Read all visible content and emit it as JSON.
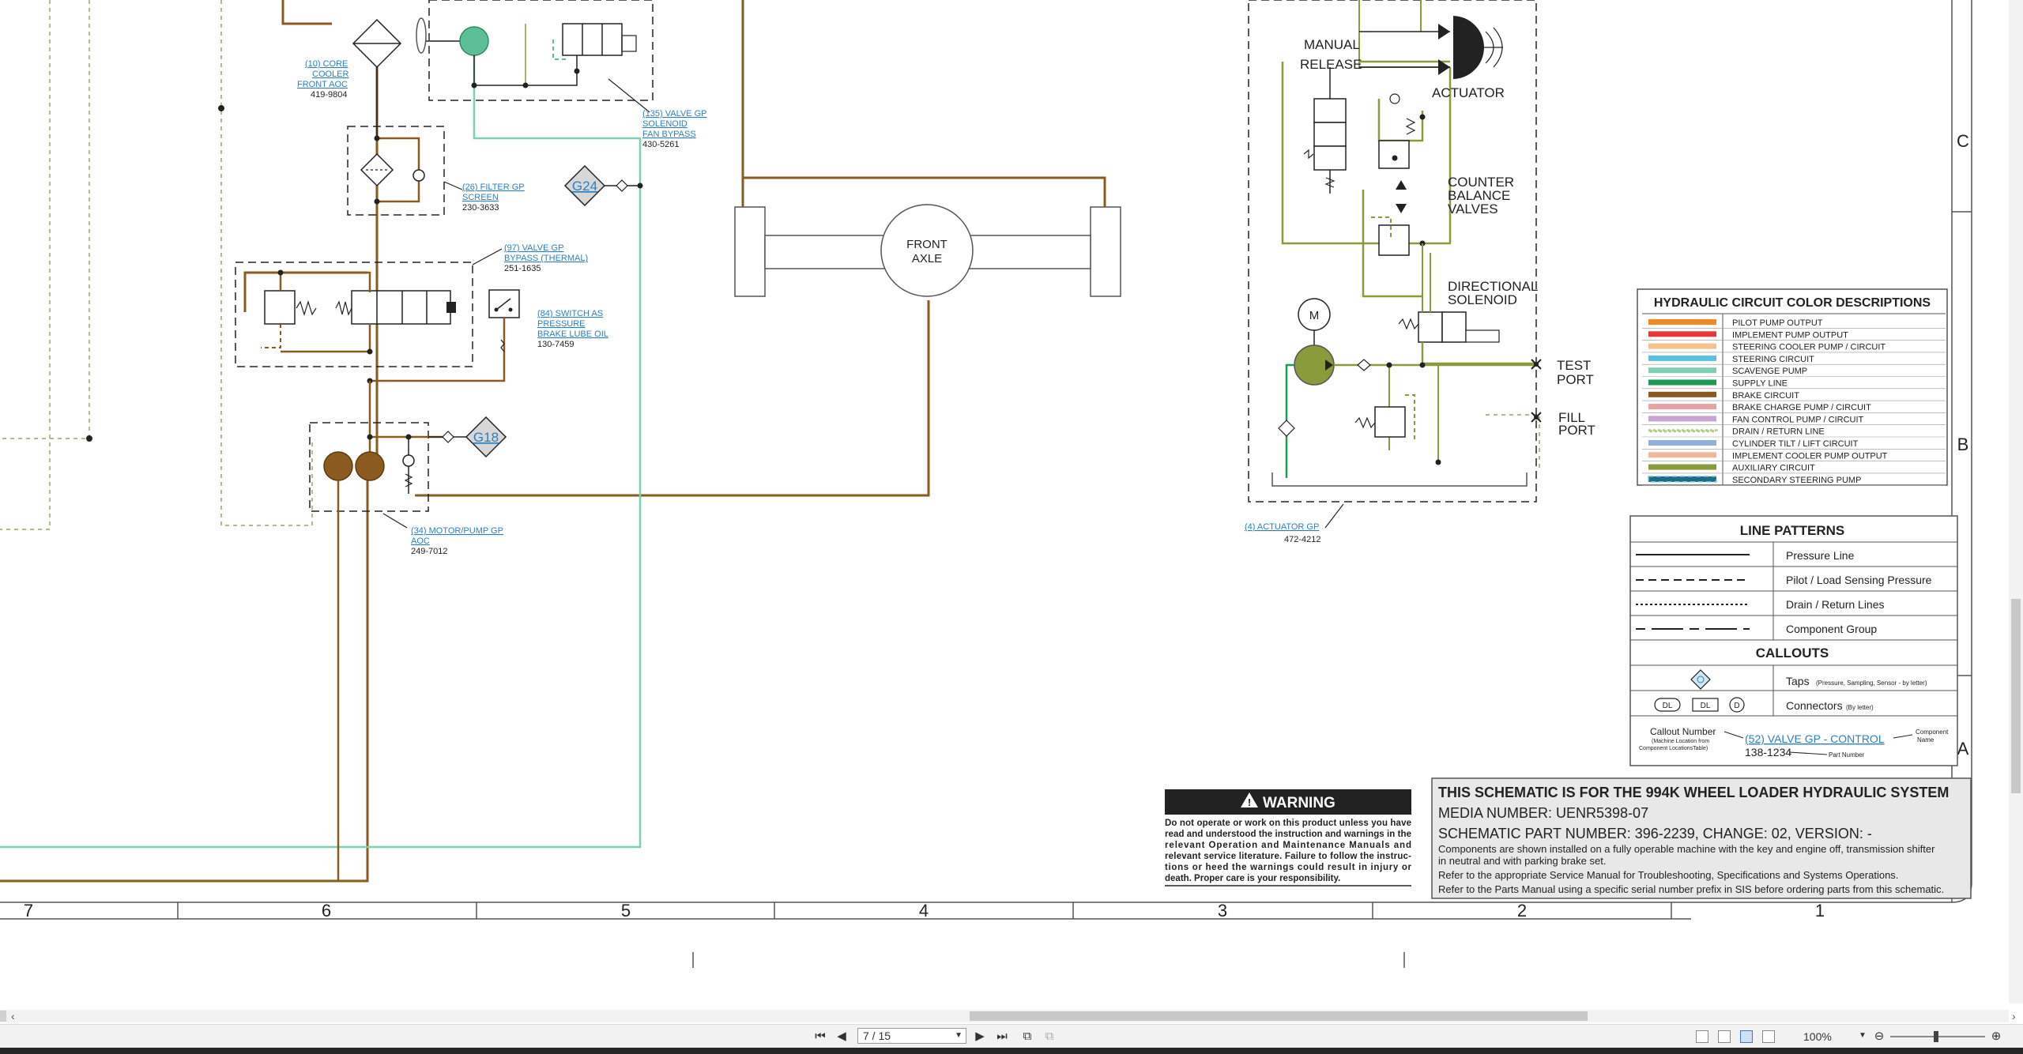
{
  "drawing": {
    "components": [
      {
        "callout": "(10) CORE",
        "callout2": "COOLER",
        "callout3": "FRONT AOC",
        "part": "419-9804"
      },
      {
        "callout": "(135) VALVE GP",
        "callout2": "SOLENOID",
        "callout3": "FAN BYPASS",
        "part": "430-5261"
      },
      {
        "callout": "(26) FILTER GP",
        "callout2": "SCREEN",
        "part": "230-3633"
      },
      {
        "callout": "(97) VALVE GP",
        "callout2": "BYPASS (THERMAL)",
        "part": "251-1635"
      },
      {
        "callout": "(84) SWITCH AS",
        "callout2": "PRESSURE",
        "callout3": "BRAKE LUBE OIL",
        "part": "130-7459"
      },
      {
        "callout": "(34) MOTOR/PUMP GP",
        "callout2": "AOC",
        "part": "249-7012"
      },
      {
        "callout": "(4) ACTUATOR GP",
        "part": "472-4212"
      }
    ],
    "taps": [
      "G24",
      "G18"
    ],
    "front_axle": [
      "FRONT",
      "AXLE"
    ],
    "labels": {
      "manual": "MANUAL",
      "release": "RELEASE",
      "actuator": "ACTUATOR",
      "counter": "COUNTER",
      "balance": "BALANCE",
      "valves": "VALVES",
      "directional": "DIRECTIONAL",
      "solenoid": "SOLENOID",
      "motor": "M",
      "test": "TEST",
      "test_port": "PORT",
      "fill": "FILL",
      "fill_port": "PORT"
    },
    "grid_columns": [
      "7",
      "6",
      "5",
      "4",
      "3",
      "2",
      "1"
    ],
    "grid_rows": [
      "C",
      "B",
      "A"
    ]
  },
  "legend_colors": {
    "title": "HYDRAULIC CIRCUIT COLOR DESCRIPTIONS",
    "items": [
      {
        "color": "#f08a24",
        "label": "PILOT PUMP OUTPUT"
      },
      {
        "color": "#e8373a",
        "label": "IMPLEMENT PUMP OUTPUT"
      },
      {
        "color": "#f5c28e",
        "label": "STEERING COOLER PUMP / CIRCUIT"
      },
      {
        "color": "#58c0e0",
        "label": "STEERING CIRCUIT"
      },
      {
        "color": "#7fd0b0",
        "label": "SCAVENGE PUMP"
      },
      {
        "color": "#1f9a55",
        "label": "SUPPLY LINE"
      },
      {
        "color": "#8b5a1e",
        "label": "BRAKE CIRCUIT"
      },
      {
        "color": "#e7a3a3",
        "label": "BRAKE CHARGE PUMP / CIRCUIT"
      },
      {
        "color": "#c9a3d6",
        "label": "FAN CONTROL PUMP / CIRCUIT"
      },
      {
        "color": "#b5c98a",
        "label": "DRAIN / RETURN LINE"
      },
      {
        "color": "#8fb0d8",
        "label": "CYLINDER TILT / LIFT CIRCUIT"
      },
      {
        "color": "#eeb99b",
        "label": "IMPLEMENT COOLER PUMP OUTPUT"
      },
      {
        "color": "#8a9b3c",
        "label": "AUXILIARY CIRCUIT"
      },
      {
        "color": "#1a6f86",
        "label": "SECONDARY STEERING PUMP"
      }
    ]
  },
  "legend_lines": {
    "title": "LINE PATTERNS",
    "items": [
      "Pressure Line",
      "Pilot / Load Sensing Pressure",
      "Drain / Return Lines",
      "Component Group"
    ]
  },
  "callouts": {
    "title": "CALLOUTS",
    "taps_label": "Taps",
    "taps_note": "(Pressure, Sampling, Sensor - by letter)",
    "connectors_label": "Connectors",
    "connectors_note": "(By letter)",
    "connector_samples": [
      "DL",
      "DL",
      "D"
    ],
    "example_callout_number": "Callout Number",
    "example_note": "(Machine Location from",
    "example_note2": "Component LocationsTable)",
    "example_name": "(52) VALVE GP - CONTROL",
    "example_component": "Component",
    "example_component2": "Name",
    "example_part": "138-1234",
    "example_part_label": "Part Number"
  },
  "warning": {
    "title": "WARNING",
    "lines": [
      "Do not operate or work on this product unless you have",
      "read and understood the instruction and warnings in the",
      "relevant Operation and Maintenance Manuals and",
      "relevant service literature. Failure to follow the instruc-",
      "tions or heed the warnings could result in injury or",
      "death. Proper care is your responsibility."
    ]
  },
  "title_block": {
    "title": "THIS SCHEMATIC IS FOR THE 994K WHEEL LOADER HYDRAULIC SYSTEM",
    "media": "MEDIA NUMBER: UENR5398-07",
    "part": "SCHEMATIC PART NUMBER: 396-2239, CHANGE: 02, VERSION: -",
    "notes": [
      "Components are shown installed on a fully operable machine with the key and engine off, transmission shifter",
      "in neutral and with parking brake set.",
      "Refer to the appropriate Service Manual for Troubleshooting, Specifications and Systems Operations.",
      "Refer to the Parts Manual using a specific serial number prefix in SIS before ordering parts from this schematic."
    ]
  },
  "toolbar": {
    "page_value": "7 / 15",
    "zoom": "100%"
  }
}
